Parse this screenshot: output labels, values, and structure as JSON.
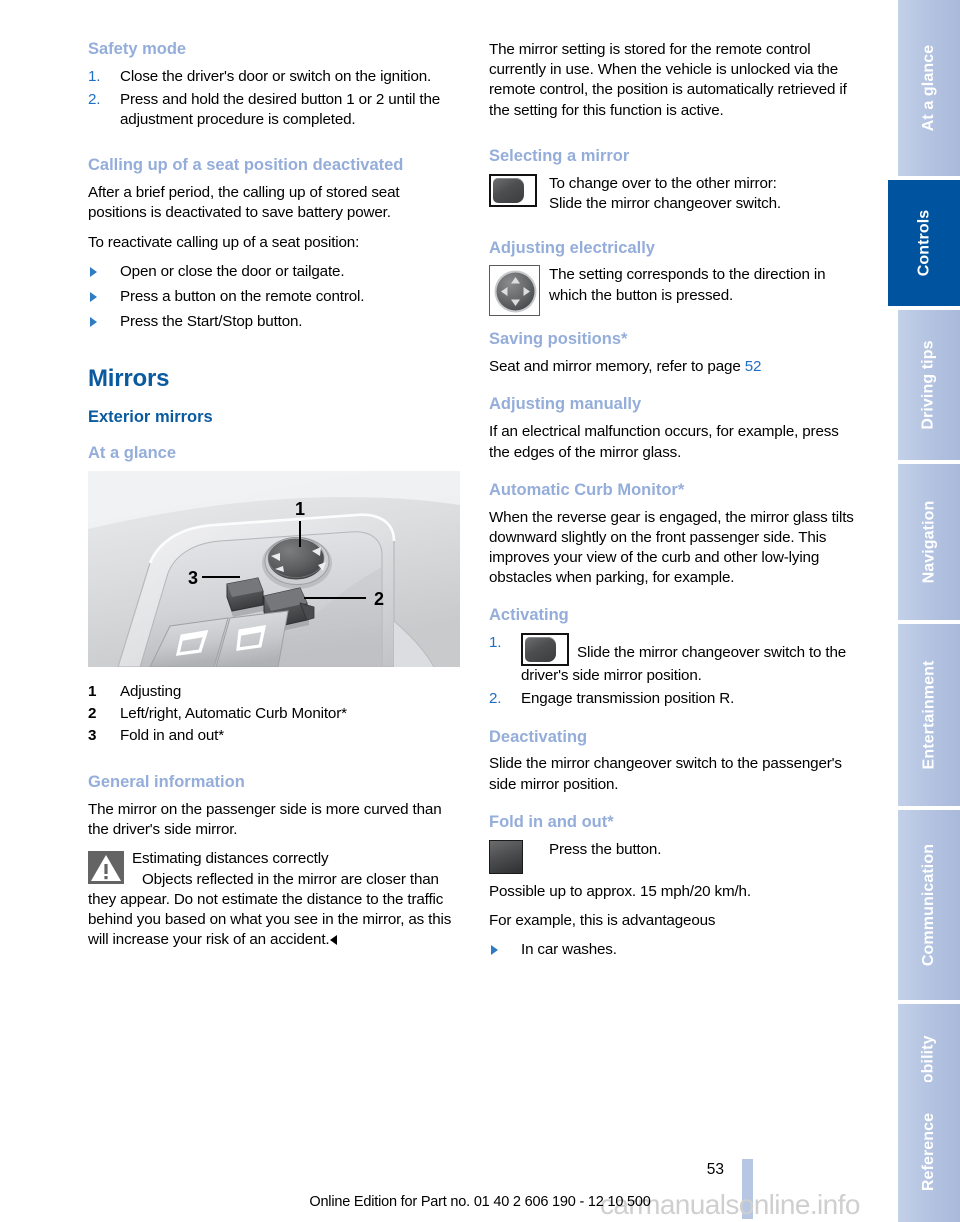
{
  "document": {
    "page_number": "53",
    "footer_text": "Online Edition for Part no. 01 40 2 606 190 - 12 10 500",
    "watermark": "carmanualsonline.info"
  },
  "left_column": {
    "safety_mode": {
      "heading": "Safety mode",
      "steps": [
        "Close the driver's door or switch on the ignition.",
        "Press and hold the desired button 1 or 2 until the adjustment procedure is completed."
      ]
    },
    "calling_up": {
      "heading": "Calling up of a seat position deactivated",
      "para1": "After a brief period, the calling up of stored seat positions is deactivated to save battery power.",
      "para2": "To reactivate calling up of a seat position:",
      "bullets": [
        "Open or close the door or tailgate.",
        "Press a button on the remote control.",
        "Press the Start/Stop button."
      ]
    },
    "mirrors": {
      "title": "Mirrors",
      "subtitle": "Exterior mirrors",
      "at_a_glance": "At a glance",
      "illustration_labels": [
        "1",
        "2",
        "3"
      ],
      "legend": [
        {
          "num": "1",
          "label": "Adjusting"
        },
        {
          "num": "2",
          "label": "Left/right, Automatic Curb Monitor*"
        },
        {
          "num": "3",
          "label": "Fold in and out*"
        }
      ]
    },
    "general_information": {
      "heading": "General information",
      "para": "The mirror on the passenger side is more curved than the driver's side mirror.",
      "warning": {
        "icon": "warning-triangle-icon",
        "title": "Estimating distances correctly",
        "body_first": "Objects reflected in the mirror are closer",
        "body_rest": "than they appear. Do not estimate the distance to the traffic behind you based on what you see in the mirror, as this will increase your risk of an accident."
      }
    }
  },
  "right_column": {
    "intro_para": "The mirror setting is stored for the remote control currently in use. When the vehicle is unlocked via the remote control, the position is automatically retrieved if the setting for this function is active.",
    "selecting_a_mirror": {
      "heading": "Selecting a mirror",
      "icon": "mirror-changeover-switch-icon",
      "line1": "To change over to the other mirror:",
      "line2": "Slide the mirror changeover switch."
    },
    "adjusting_electrically": {
      "heading": "Adjusting electrically",
      "icon": "four-way-rocker-knob-icon",
      "text": "The setting corresponds to the direction in which the button is pressed."
    },
    "saving_positions": {
      "heading": "Saving positions*",
      "text_before": "Seat and mirror memory, refer to page ",
      "page_ref": "52"
    },
    "adjusting_manually": {
      "heading": "Adjusting manually",
      "text": "If an electrical malfunction occurs, for example, press the edges of the mirror glass."
    },
    "automatic_curb_monitor": {
      "heading": "Automatic Curb Monitor*",
      "text": "When the reverse gear is engaged, the mirror glass tilts downward slightly on the front passenger side. This improves your view of the curb and other low-lying obstacles when parking, for example."
    },
    "activating": {
      "heading": "Activating",
      "step1_icon": "mirror-changeover-switch-icon",
      "step1": "Slide the mirror changeover switch to the driver's side mirror position.",
      "step2": "Engage transmission position R."
    },
    "deactivating": {
      "heading": "Deactivating",
      "text": "Slide the mirror changeover switch to the passenger's side mirror position."
    },
    "fold_in_and_out": {
      "heading": "Fold in and out*",
      "icon": "fold-button-icon",
      "icon_text": "Press the button.",
      "para1": "Possible up to approx. 15 mph/20 km/h.",
      "para2": "For example, this is advantageous",
      "bullets": [
        "In car washes."
      ]
    }
  },
  "sidebar": {
    "active_index": 1,
    "tabs": [
      {
        "label": "At a glance",
        "active": false
      },
      {
        "label": "Controls",
        "active": true
      },
      {
        "label": "Driving tips",
        "active": false
      },
      {
        "label": "Navigation",
        "active": false
      },
      {
        "label": "Entertainment",
        "active": false
      },
      {
        "label": "Communication",
        "active": false
      },
      {
        "label": "Mobility",
        "active": false
      },
      {
        "label": "Reference",
        "active": false
      }
    ]
  },
  "colors": {
    "heading_dark_blue": "#0a5aa0",
    "heading_light_blue": "#94adda",
    "link_blue": "#1f6fc4",
    "tab_active": "#00549f",
    "tab_inactive": "#b2c2e0"
  }
}
